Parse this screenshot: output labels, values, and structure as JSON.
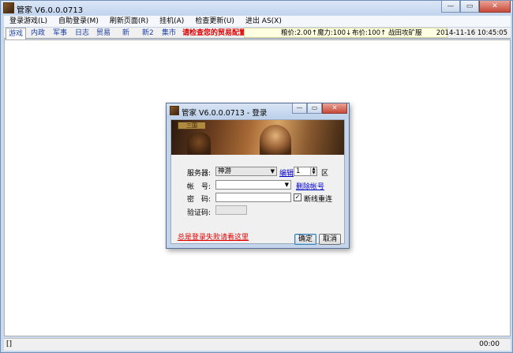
{
  "window": {
    "title": "管家 V6.0.0.0713"
  },
  "menu": [
    "登录游戏(L)",
    "自助登录(M)",
    "刷新页面(R)",
    "挂机(A)",
    "检查更新(U)",
    "进出 AS(X)"
  ],
  "tabs": [
    "游戏",
    "内政",
    "军事",
    "日志",
    "贸易",
    "新",
    "新2",
    "集市"
  ],
  "notice": "请检查您的贸易配置",
  "resources": {
    "grain": "粮价:2.00↑",
    "mana": "魔力:100↓",
    "cloth": "布价:100↑",
    "battle": "战田攻矿服"
  },
  "datetime": "2014-11-16 10:45:05",
  "status": {
    "left": "[]",
    "right": "00:00"
  },
  "dialog": {
    "title": "管家 V6.0.0.0713 - 登录",
    "banner_logo": "三国",
    "server_label": "服务器:",
    "server_value": "神游",
    "edit_link": "编辑",
    "zone_value": "1",
    "zone_suffix": "区",
    "account_label": "帐　号:",
    "delete_account_link": "删除帐号",
    "password_label": "密　码:",
    "reconnect_label": "断线重连",
    "reconnect_checked": true,
    "captcha_label": "验证码:",
    "help_link": "总是登录失败请看这里",
    "ok_label": "确定",
    "cancel_label": "取消"
  }
}
